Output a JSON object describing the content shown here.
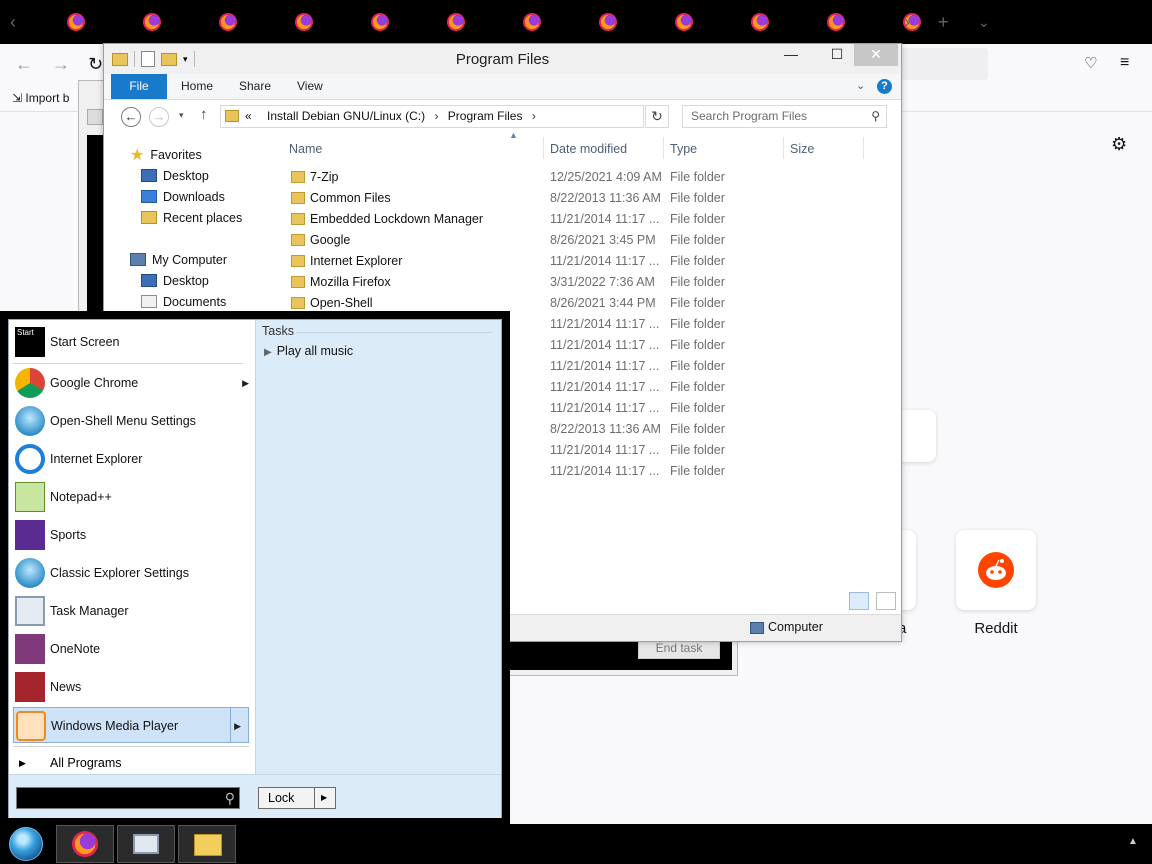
{
  "colors": {
    "accent": "#1979ca",
    "taskbar": "#000000",
    "selected_item": "#cfe3f8",
    "folder": "#e8c45a"
  },
  "firefox": {
    "tab_count": 12,
    "tab_icon": "firefox-icon",
    "bookmarks_import": "Import b",
    "reddit_label": "Reddit",
    "partial_tile_label": "a"
  },
  "background_window": {
    "end_task_label": "End task"
  },
  "explorer": {
    "title": "Program Files",
    "ribbon_tabs": [
      "File",
      "Home",
      "Share",
      "View"
    ],
    "address": {
      "prefix": "«",
      "crumbs": [
        "Install Debian GNU/Linux (C:)",
        "Program Files"
      ]
    },
    "search_placeholder": "Search Program Files",
    "nav": {
      "favorites": "Favorites",
      "favorites_items": [
        "Desktop",
        "Downloads",
        "Recent places"
      ],
      "computer": "My Computer",
      "computer_items": [
        "Desktop",
        "Documents"
      ]
    },
    "columns": {
      "name": "Name",
      "date": "Date modified",
      "type": "Type",
      "size": "Size"
    },
    "files": [
      {
        "name": "7-Zip",
        "date": "12/25/2021 4:09 AM",
        "type": "File folder"
      },
      {
        "name": "Common Files",
        "date": "8/22/2013 11:36 AM",
        "type": "File folder"
      },
      {
        "name": "Embedded Lockdown Manager",
        "date": "11/21/2014 11:17 ...",
        "type": "File folder"
      },
      {
        "name": "Google",
        "date": "8/26/2021 3:45 PM",
        "type": "File folder"
      },
      {
        "name": "Internet Explorer",
        "date": "11/21/2014 11:17 ...",
        "type": "File folder"
      },
      {
        "name": "Mozilla Firefox",
        "date": "3/31/2022 7:36 AM",
        "type": "File folder"
      },
      {
        "name": "Open-Shell",
        "date": "8/26/2021 3:44 PM",
        "type": "File folder"
      },
      {
        "name": "",
        "date": "11/21/2014 11:17 ...",
        "type": "File folder"
      },
      {
        "name": "",
        "date": "11/21/2014 11:17 ...",
        "type": "File folder"
      },
      {
        "name": "",
        "date": "11/21/2014 11:17 ...",
        "type": "File folder"
      },
      {
        "name": "",
        "date": "11/21/2014 11:17 ...",
        "type": "File folder"
      },
      {
        "name": "",
        "date": "11/21/2014 11:17 ...",
        "type": "File folder"
      },
      {
        "name": "",
        "date": "8/22/2013 11:36 AM",
        "type": "File folder"
      },
      {
        "name": "",
        "date": "11/21/2014 11:17 ...",
        "type": "File folder"
      },
      {
        "name": "",
        "date": "11/21/2014 11:17 ...",
        "type": "File folder"
      }
    ],
    "status_computer": "Computer"
  },
  "start_menu": {
    "items": [
      {
        "label": "Start Screen",
        "icon": "start-screen-icon",
        "arrow": false
      },
      {
        "label": "Google Chrome",
        "icon": "chrome-icon",
        "arrow": true
      },
      {
        "label": "Open-Shell Menu Settings",
        "icon": "open-shell-icon",
        "arrow": false
      },
      {
        "label": "Internet Explorer",
        "icon": "internet-explorer-icon",
        "arrow": false
      },
      {
        "label": "Notepad++",
        "icon": "notepad-plus-plus-icon",
        "arrow": false
      },
      {
        "label": "Sports",
        "icon": "sports-trophy-icon",
        "arrow": false
      },
      {
        "label": "Classic Explorer Settings",
        "icon": "classic-explorer-icon",
        "arrow": false
      },
      {
        "label": "Task Manager",
        "icon": "task-manager-icon",
        "arrow": false
      },
      {
        "label": "OneNote",
        "icon": "onenote-icon",
        "arrow": false
      },
      {
        "label": "News",
        "icon": "news-icon",
        "arrow": false
      },
      {
        "label": "Windows Media Player",
        "icon": "media-player-icon",
        "arrow": true
      }
    ],
    "all_programs": "All Programs",
    "tasks_header": "Tasks",
    "tasks": [
      "Play all music"
    ],
    "lock_label": "Lock",
    "start_icon_text": "Start"
  },
  "taskbar": {
    "buttons": [
      "firefox-icon",
      "task-manager-icon",
      "file-explorer-icon"
    ]
  }
}
